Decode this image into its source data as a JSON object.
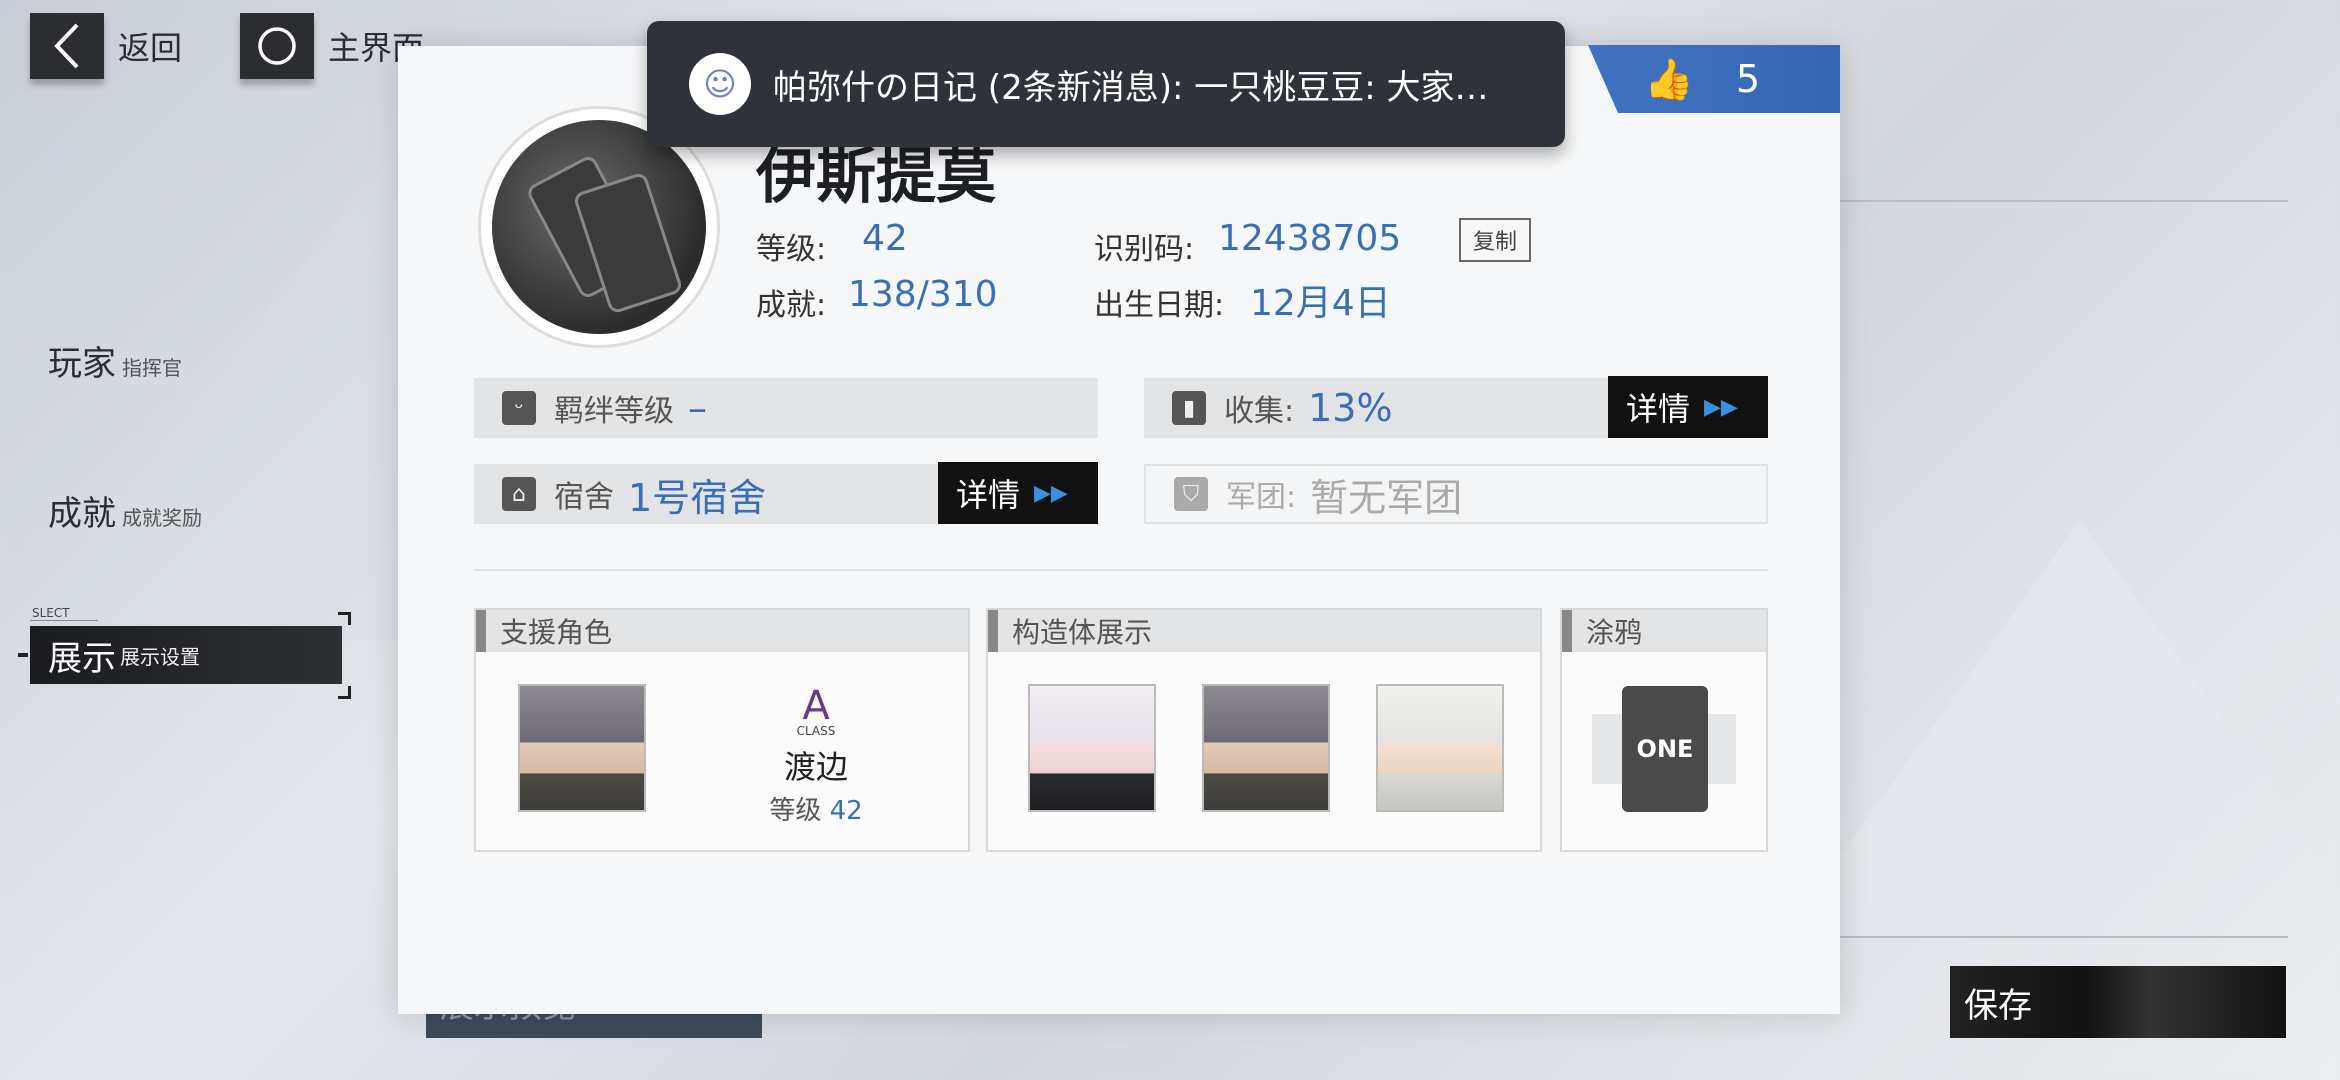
{
  "topbar": {
    "back_label": "返回",
    "home_label": "主界面"
  },
  "sidebar": {
    "items": [
      {
        "label": "玩家",
        "sub": "指挥官"
      },
      {
        "label": "成就",
        "sub": "成就奖励"
      },
      {
        "label": "展示",
        "sub": "展示设置",
        "tag": "SLECT"
      }
    ]
  },
  "notification": {
    "text": "帕弥什の日记 (2条新消息): 一只桃豆豆: 大家…"
  },
  "likes": {
    "count": "5"
  },
  "profile": {
    "name": "伊斯提莫",
    "level_label": "等级:",
    "level": "42",
    "id_label": "识别码:",
    "id": "12438705",
    "copy_label": "复制",
    "achievement_label": "成就:",
    "achievement": "138/310",
    "birthday_label": "出生日期:",
    "birthday": "12月4日"
  },
  "bond": {
    "label": "羁绊等级",
    "value": "–"
  },
  "collection": {
    "label": "收集:",
    "value": "13%",
    "detail": "详情"
  },
  "dorm": {
    "label": "宿舍",
    "value": "1号宿舍",
    "detail": "详情"
  },
  "legion": {
    "label": "军团:",
    "value": "暂无军团"
  },
  "support": {
    "title": "支援角色",
    "class": "CLASS",
    "rank": "A",
    "name": "渡边",
    "level_label": "等级",
    "level": "42"
  },
  "constructs": {
    "title": "构造体展示"
  },
  "graffiti": {
    "title": "涂鸦",
    "card_text": "ONE"
  },
  "buttons": {
    "save": "保存",
    "left_hidden": "展示预览"
  },
  "colors": {
    "accent_blue": "#3a6fb8",
    "likes_bg": "#3f73c2",
    "toast_bg": "#2f3238"
  }
}
